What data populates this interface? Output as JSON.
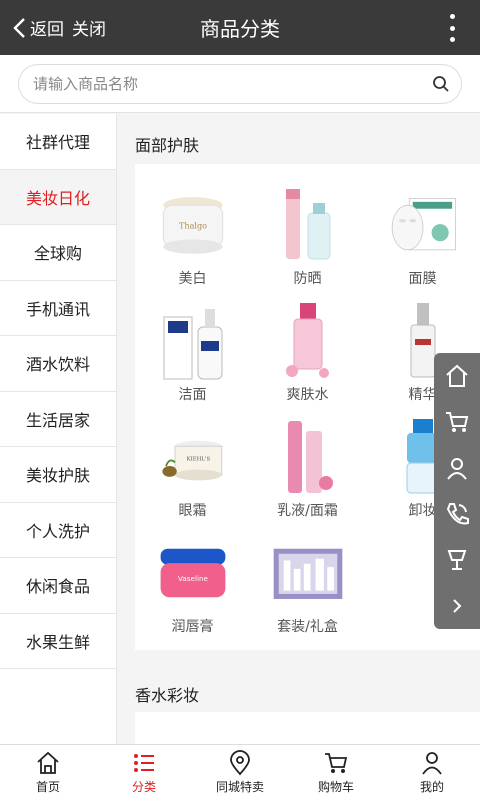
{
  "header": {
    "back_label": "返回",
    "close_label": "关闭",
    "title": "商品分类"
  },
  "search": {
    "placeholder": "请输入商品名称"
  },
  "sidebar": {
    "items": [
      {
        "label": "社群代理"
      },
      {
        "label": "美妆日化",
        "active": true
      },
      {
        "label": "全球购"
      },
      {
        "label": "手机通讯"
      },
      {
        "label": "酒水饮料"
      },
      {
        "label": "生活居家"
      },
      {
        "label": "美妆护肤"
      },
      {
        "label": "个人洗护"
      },
      {
        "label": "休闲食品"
      },
      {
        "label": "水果生鲜"
      }
    ]
  },
  "sections": [
    {
      "title": "面部护肤",
      "items": [
        {
          "label": "美白",
          "icon": "cream-jar-image"
        },
        {
          "label": "防晒",
          "icon": "sunscreen-bottle-image"
        },
        {
          "label": "面膜",
          "icon": "face-mask-image"
        },
        {
          "label": "洁面",
          "icon": "cleanser-image"
        },
        {
          "label": "爽肤水",
          "icon": "toner-bottle-image"
        },
        {
          "label": "精华",
          "icon": "serum-bottle-image"
        },
        {
          "label": "眼霜",
          "icon": "eye-cream-image"
        },
        {
          "label": "乳液/面霜",
          "icon": "lotion-bottle-image"
        },
        {
          "label": "卸妆",
          "icon": "makeup-remover-image"
        },
        {
          "label": "润唇膏",
          "icon": "lip-balm-image"
        },
        {
          "label": "套装/礼盒",
          "icon": "gift-set-image"
        }
      ]
    },
    {
      "title": "香水彩妆",
      "items": []
    }
  ],
  "tabbar": {
    "tabs": [
      {
        "label": "首页"
      },
      {
        "label": "分类",
        "active": true
      },
      {
        "label": "同城特卖"
      },
      {
        "label": "购物车"
      },
      {
        "label": "我的"
      }
    ]
  },
  "colors": {
    "header_bg": "#3a3a3a",
    "accent": "#e02020",
    "float_bar": "#6f6f6f"
  }
}
